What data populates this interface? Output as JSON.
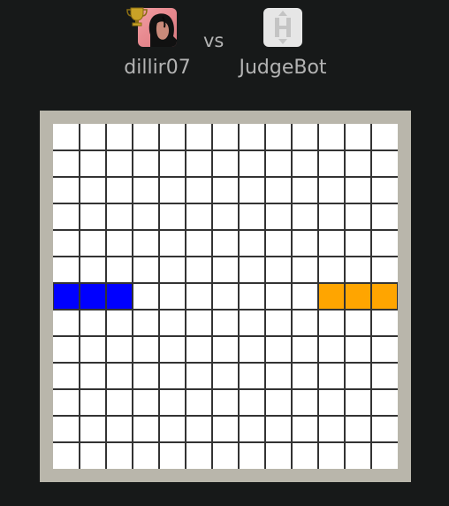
{
  "players": {
    "left": {
      "name": "dillir07",
      "icon": "trophy-icon",
      "avatar": "user-avatar"
    },
    "vs_label": "vs",
    "right": {
      "name": "JudgeBot",
      "icon": "bot-h-icon",
      "avatar": "bot-avatar"
    }
  },
  "board": {
    "rows": 13,
    "cols": 13,
    "cell_color": "#ffffff",
    "line_color": "#333333",
    "frame_color": "#b9b6ab",
    "pieces": [
      {
        "player": "dillir07",
        "color": "#0000ff",
        "row": 6,
        "cols": [
          0,
          1,
          2
        ]
      },
      {
        "player": "JudgeBot",
        "color": "#ffa500",
        "row": 6,
        "cols": [
          10,
          11,
          12
        ]
      }
    ]
  }
}
